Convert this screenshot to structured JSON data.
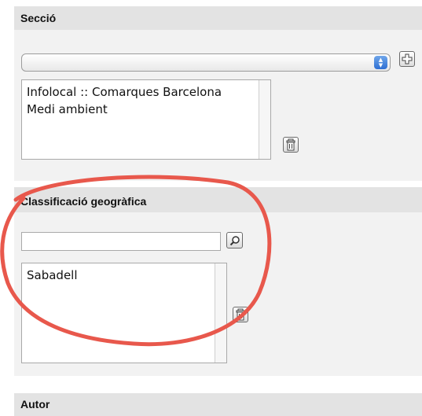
{
  "seccio": {
    "title": "Secció",
    "select_value": "",
    "list_items": [
      "Infolocal :: Comarques Barcelona",
      "Medi ambient"
    ],
    "add_icon": "plus-icon",
    "delete_icon": "trash-icon"
  },
  "classificacio": {
    "title": "Classificació geogràfica",
    "search_value": "",
    "search_icon": "magnifier-icon",
    "list_items": [
      "Sabadell"
    ],
    "delete_icon": "trash-icon"
  },
  "autor": {
    "title": "Autor"
  },
  "colors": {
    "header_bg": "#e3e3e3",
    "panel_bg": "#f2f2f2",
    "annotation_ellipse": "#e8584c"
  }
}
